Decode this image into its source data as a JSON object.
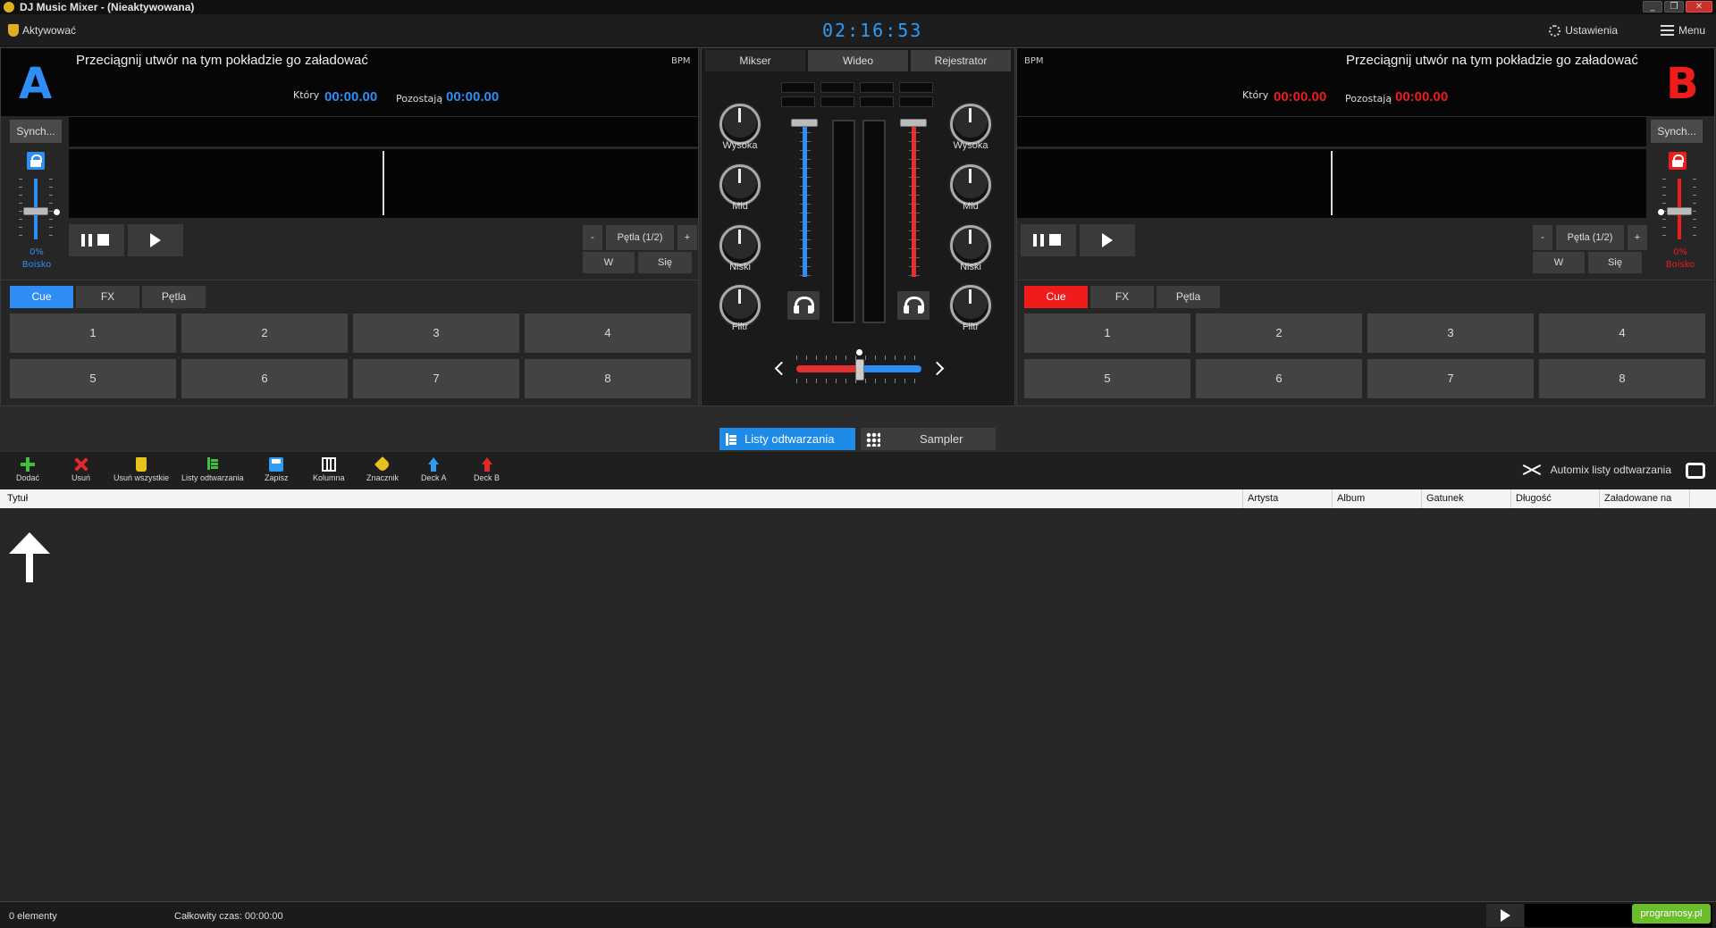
{
  "window": {
    "title": "DJ Music Mixer - (Nieaktywowana)",
    "controls": [
      "_",
      "❐",
      "✕"
    ]
  },
  "toolbar": {
    "activate_label": "Aktywować",
    "clock": "02:16:53",
    "settings_label": "Ustawienia",
    "menu_label": "Menu"
  },
  "deck_a": {
    "letter": "A",
    "prompt": "Przeciągnij utwór na tym pokładzie go załadować",
    "bpm_label": "BPM",
    "elapsed_label": "Który",
    "elapsed_value": "00:00.00",
    "remaining_label": "Pozostają",
    "remaining_value": "00:00.00",
    "sync_label": "Synch...",
    "pitch_percent": "0%",
    "pitch_label": "Boisko",
    "loop_minus": "-",
    "loop_label": "Pętla (1/2)",
    "loop_plus": "+",
    "loop_in": "W",
    "loop_out": "Się",
    "modes": [
      "Cue",
      "FX",
      "Pętla"
    ],
    "pads": [
      "1",
      "2",
      "3",
      "4",
      "5",
      "6",
      "7",
      "8"
    ],
    "accent": "#2e8ef5"
  },
  "deck_b": {
    "letter": "B",
    "prompt": "Przeciągnij utwór na tym pokładzie go załadować",
    "bpm_label": "BPM",
    "elapsed_label": "Który",
    "elapsed_value": "00:00.00",
    "remaining_label": "Pozostają",
    "remaining_value": "00:00.00",
    "sync_label": "Synch...",
    "pitch_percent": "0%",
    "pitch_label": "Boisko",
    "loop_minus": "-",
    "loop_label": "Pętla (1/2)",
    "loop_plus": "+",
    "loop_in": "W",
    "loop_out": "Się",
    "modes": [
      "Cue",
      "FX",
      "Pętla"
    ],
    "pads": [
      "1",
      "2",
      "3",
      "4",
      "5",
      "6",
      "7",
      "8"
    ],
    "accent": "#f01c1c"
  },
  "mixer": {
    "tabs": [
      "Mikser",
      "Wideo",
      "Rejestrator"
    ],
    "knobs": [
      "Wysoka",
      "Mid",
      "Niski",
      "Filtr"
    ]
  },
  "library": {
    "tabs": [
      "Listy odtwarzania",
      "Sampler"
    ],
    "tools": [
      "Dodać",
      "Usuń",
      "Usuń wszystkie",
      "Listy odtwarzania",
      "Zapisz",
      "Kolumna",
      "Znacznik",
      "Deck A",
      "Deck B"
    ],
    "automix_label": "Automix listy odtwarzania",
    "columns": [
      "Tytuł",
      "Artysta",
      "Album",
      "Gatunek",
      "Długość",
      "Załadowane na"
    ]
  },
  "status": {
    "count_label": "0  elementy",
    "total_label": "Całkowity czas: 00:00:00",
    "watermark": "programosy.pl"
  }
}
